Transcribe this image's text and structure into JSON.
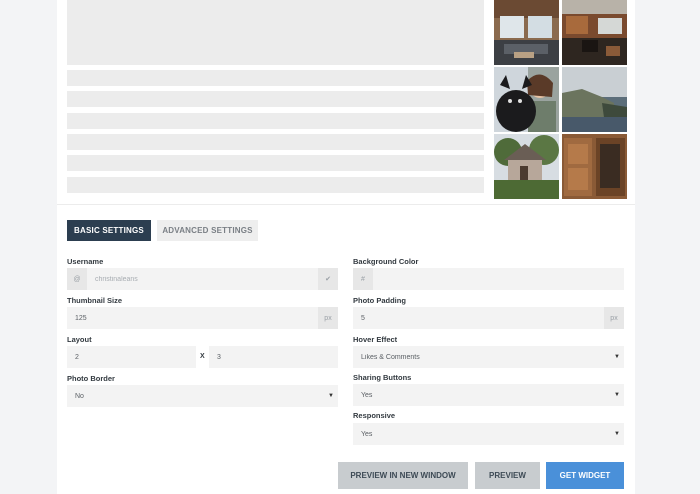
{
  "tabs": {
    "basic": "BASIC SETTINGS",
    "advanced": "ADVANCED SETTINGS"
  },
  "username": {
    "label": "Username",
    "prefix": "@",
    "value": "christinaleans",
    "check": "✔"
  },
  "thumbnail_size": {
    "label": "Thumbnail Size",
    "value": "125",
    "unit": "px"
  },
  "layout": {
    "label": "Layout",
    "cols": "2",
    "sep": "X",
    "rows": "3"
  },
  "photo_border": {
    "label": "Photo Border",
    "value": "No"
  },
  "background_color": {
    "label": "Background Color",
    "prefix": "#",
    "value": ""
  },
  "photo_padding": {
    "label": "Photo Padding",
    "value": "5",
    "unit": "px"
  },
  "hover_effect": {
    "label": "Hover Effect",
    "value": "Likes & Comments"
  },
  "sharing_buttons": {
    "label": "Sharing Buttons",
    "value": "Yes"
  },
  "responsive": {
    "label": "Responsive",
    "value": "Yes"
  },
  "buttons": {
    "preview_new_window": "PREVIEW IN NEW WINDOW",
    "preview": "PREVIEW",
    "get_widget": "GET WIDGET"
  },
  "caret": "▼",
  "colors": {
    "active_tab": "#2c3e50",
    "primary_button": "#4a90d9",
    "secondary_button": "#c8cccf"
  }
}
